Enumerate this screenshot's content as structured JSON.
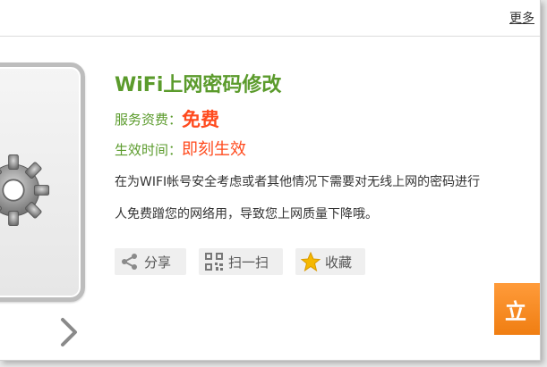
{
  "header": {
    "more_label": "更多"
  },
  "product": {
    "title": "WiFi上网密码修改",
    "fee_label": "服务资费：",
    "fee_value": "免费",
    "effect_label": "生效时间：",
    "effect_value": "即刻生效",
    "description_line1": "在为WIFI帐号安全考虑或者其他情况下需要对无线上网的密码进行",
    "description_line2": "人免费蹭您的网络用，导致您上网质量下降哦。"
  },
  "actions": {
    "share_label": "分享",
    "scan_label": "扫一扫",
    "favorite_label": "收藏",
    "order_label": "立"
  },
  "icons": {
    "share": "share-icon",
    "qr": "qr-code-icon",
    "star": "star-icon",
    "gear": "gear-icon",
    "next": "chevron-right-icon"
  },
  "colors": {
    "accent_green": "#5b9b2c",
    "highlight_red": "#ff4a1d",
    "order_orange": "#f28a1f"
  }
}
